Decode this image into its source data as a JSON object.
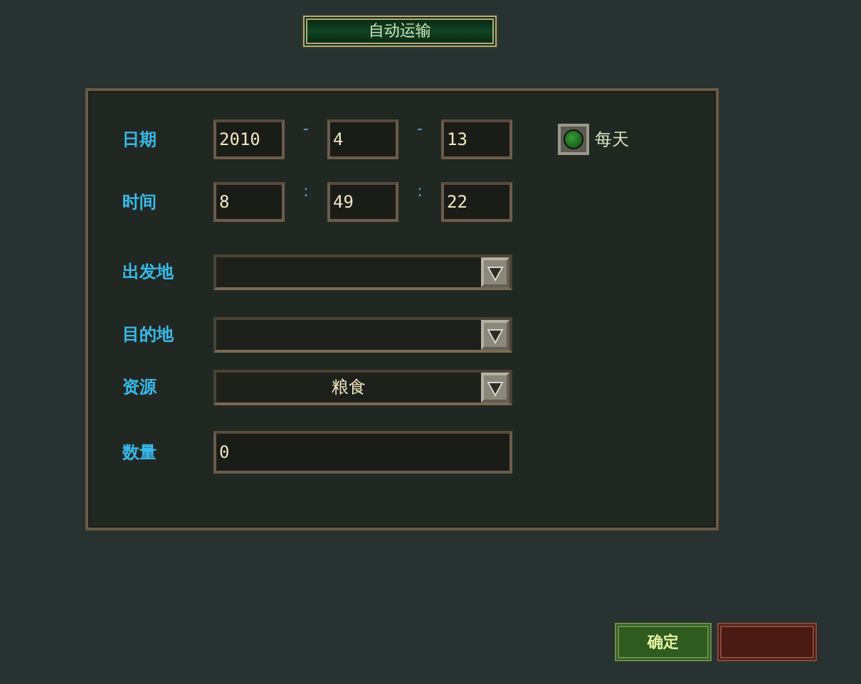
{
  "title": "自动运输",
  "rows": [
    {
      "kind": "triple",
      "label": "日期",
      "values": [
        "2010",
        "4",
        "13"
      ],
      "separators": [
        "-",
        "-"
      ],
      "toggle": {
        "label": "每天",
        "checked": true
      }
    },
    {
      "kind": "triple",
      "label": "时间",
      "values": [
        "8",
        "49",
        "22"
      ],
      "separators": [
        ":",
        ":"
      ]
    },
    {
      "kind": "select",
      "label": "出发地"
    },
    {
      "kind": "select",
      "label": "目的地"
    },
    {
      "kind": "select",
      "label": "资源",
      "value": "粮食"
    },
    {
      "kind": "input",
      "label": "数量",
      "value": "0"
    }
  ],
  "buttons": [
    {
      "kind": "confirm",
      "label": "确定"
    },
    {
      "kind": "cancel"
    }
  ]
}
